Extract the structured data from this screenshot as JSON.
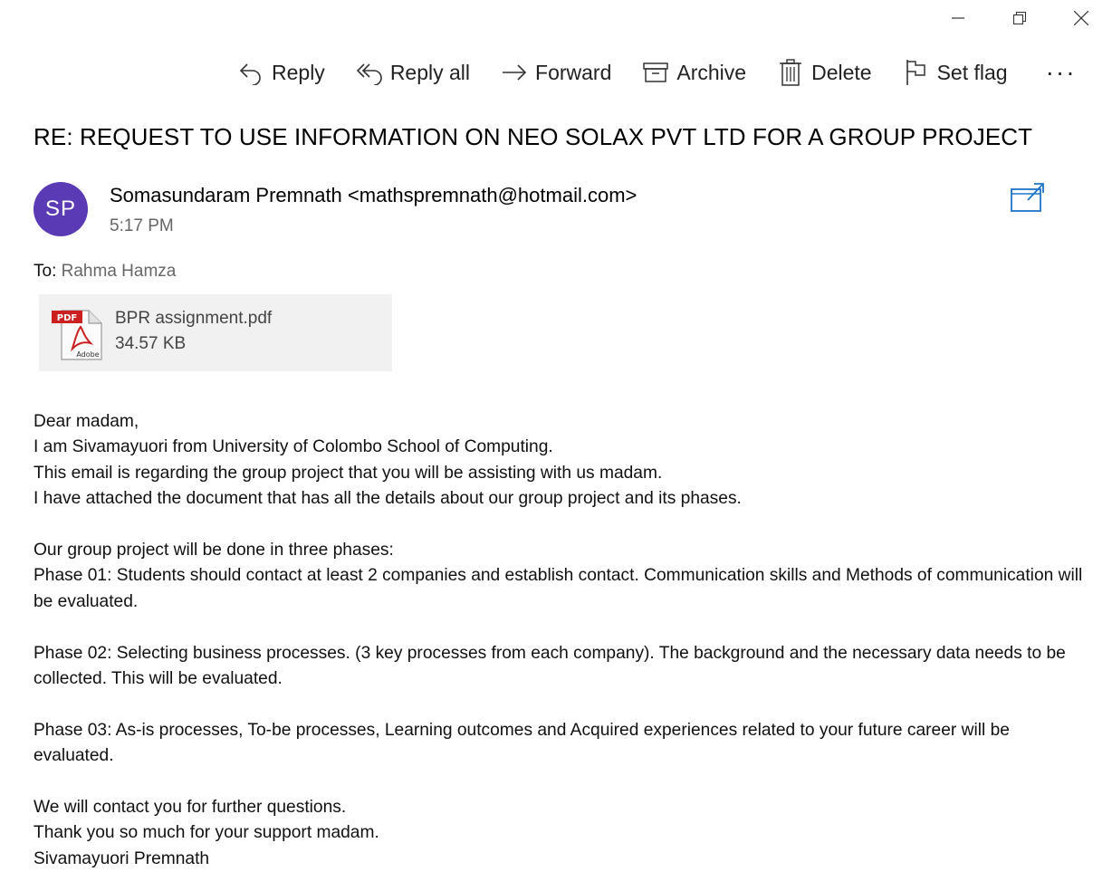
{
  "toolbar": {
    "reply": "Reply",
    "reply_all": "Reply all",
    "forward": "Forward",
    "archive": "Archive",
    "delete": "Delete",
    "set_flag": "Set flag",
    "more": "···"
  },
  "message": {
    "subject": "RE: REQUEST TO USE INFORMATION ON NEO SOLAX PVT LTD FOR A GROUP PROJECT",
    "avatar_initials": "SP",
    "sender": "Somasundaram Premnath <mathspremnath@hotmail.com>",
    "time": "5:17 PM",
    "to_label": "To:",
    "to_name": "Rahma Hamza",
    "attachment": {
      "name": "BPR assignment.pdf",
      "size": "34.57 KB",
      "icon_label": "PDF",
      "brand_label": "Adobe"
    },
    "body": [
      "Dear madam,",
      "I am Sivamayuori from University of Colombo School of Computing.",
      "This email is regarding the group project that you will be assisting with us madam.",
      "I have attached the document that has all the details about our group project and its phases.",
      "",
      "Our group project will be done in three phases:",
      "Phase 01: Students should contact at least 2 companies and establish contact. Communication skills and Methods of communication will be evaluated.",
      "",
      "Phase 02: Selecting business processes. (3 key processes from each company). The background and the necessary data needs to be collected. This will be evaluated.",
      "",
      "Phase 03: As-is processes, To-be processes, Learning outcomes and Acquired experiences related to your future career will be evaluated.",
      "",
      "We will contact you for further questions.",
      "Thank you so much for your support madam.",
      "Sivamayuori Premnath"
    ]
  },
  "colors": {
    "avatar": "#5b3ab5",
    "popout_icon": "#1e73c8",
    "attachment_bg": "#f1f1f1",
    "muted_text": "#666666"
  }
}
